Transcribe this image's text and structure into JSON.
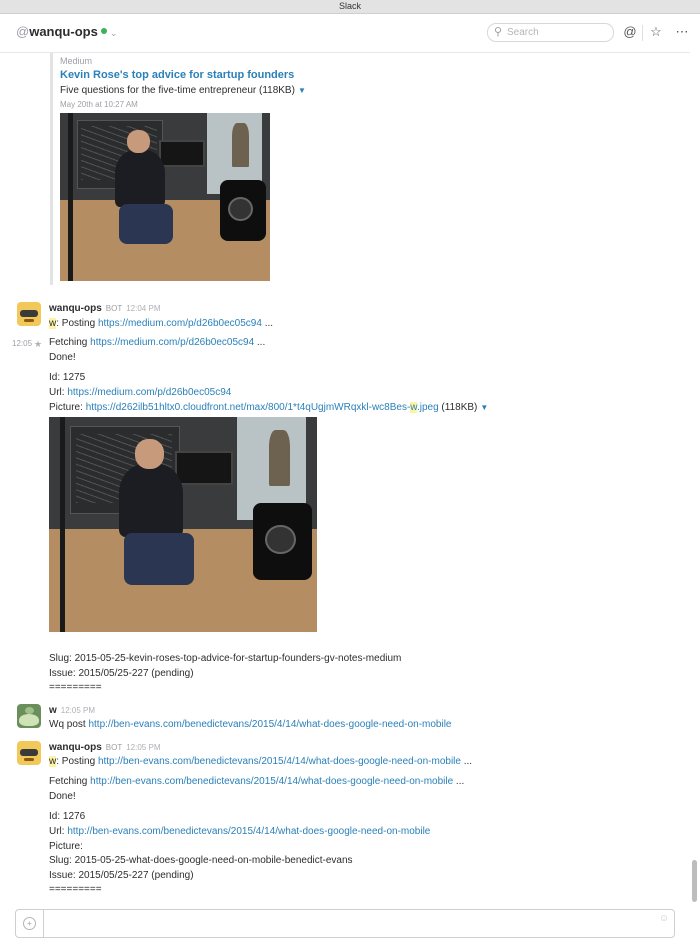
{
  "window": {
    "title": "Slack"
  },
  "header": {
    "channel_prefix": "@",
    "channel_name": "wanqu-ops",
    "search_placeholder": "Search",
    "mention_icon": "at-icon",
    "star_icon": "star-icon",
    "more_icon": "more-icon"
  },
  "attachment": {
    "source": "Medium",
    "title": "Kevin Rose's top advice for startup founders",
    "description": "Five questions for the five-time entrepreneur (118KB)",
    "date": "May 20th at 10:27 AM"
  },
  "messages": [
    {
      "author": "wanqu-ops",
      "badge": "BOT",
      "time": "12:04 PM",
      "line1_prefix": "w",
      "line1_text": ": Posting ",
      "line1_link": "https://medium.com/p/d26b0ec05c94",
      "line1_suffix": " ...",
      "hover_time": "12:05",
      "fetch_text": "Fetching ",
      "fetch_link": "https://medium.com/p/d26b0ec05c94",
      "fetch_suffix": " ...",
      "done": "Done!",
      "id_line": "Id: 1275",
      "url_label": "Url: ",
      "url_link": "https://medium.com/p/d26b0ec05c94",
      "picture_label": "Picture: ",
      "picture_link_a": "https://d262ilb51hltx0.cloudfront.net/max/800/1*t4qUgjmWRqxkl-wc8Bes-",
      "picture_link_hl": "w",
      "picture_link_b": ".jpeg",
      "picture_size": " (118KB)",
      "slug": "Slug: 2015-05-25-kevin-roses-top-advice-for-startup-founders-gv-notes-medium",
      "issue": "Issue: 2015/05/25-227 (pending)",
      "sep": "========="
    },
    {
      "author": "w",
      "time": "12:05 PM",
      "text": "Wq post ",
      "link": "http://ben-evans.com/benedictevans/2015/4/14/what-does-google-need-on-mobile"
    },
    {
      "author": "wanqu-ops",
      "badge": "BOT",
      "time": "12:05 PM",
      "line1_prefix": "w",
      "line1_text": ": Posting ",
      "line1_link": "http://ben-evans.com/benedictevans/2015/4/14/what-does-google-need-on-mobile",
      "line1_suffix": " ...",
      "fetch_text": "Fetching ",
      "fetch_link": "http://ben-evans.com/benedictevans/2015/4/14/what-does-google-need-on-mobile",
      "fetch_suffix": " ...",
      "done": "Done!",
      "id_line": "Id: 1276",
      "url_label": "Url: ",
      "url_link": "http://ben-evans.com/benedictevans/2015/4/14/what-does-google-need-on-mobile",
      "picture_label": "Picture:",
      "slug": "Slug: 2015-05-25-what-does-google-need-on-mobile-benedict-evans",
      "issue": "Issue: 2015/05/25-227 (pending)",
      "sep": "========="
    }
  ],
  "composer": {
    "value": ""
  },
  "colors": {
    "link": "#2a80b9",
    "presence": "#3ab15a",
    "highlight": "#fdf3a5"
  }
}
